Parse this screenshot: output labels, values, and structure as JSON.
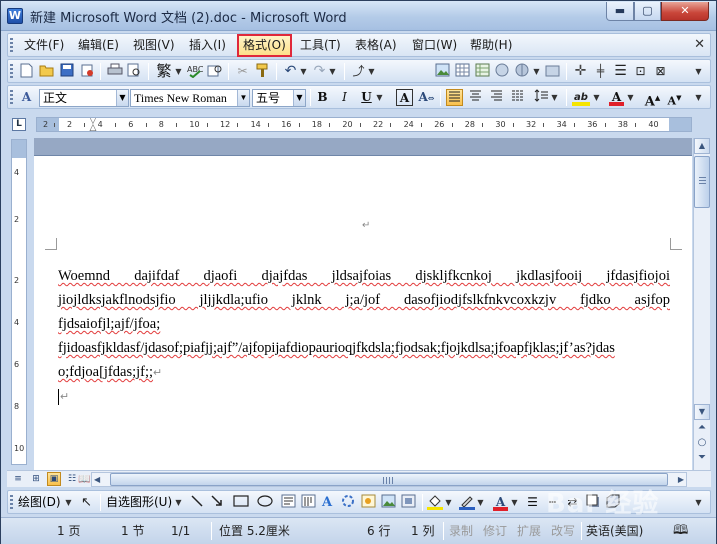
{
  "window": {
    "title": "新建 Microsoft Word 文档 (2).doc - Microsoft Word",
    "app_icon_letter": "W",
    "minimize_glyph": "▬",
    "maximize_glyph": "▢",
    "close_glyph": "✕"
  },
  "menubar": {
    "items": [
      {
        "label": "文件(F)"
      },
      {
        "label": "编辑(E)"
      },
      {
        "label": "视图(V)"
      },
      {
        "label": "插入(I)"
      },
      {
        "label": "格式(O)"
      },
      {
        "label": "工具(T)"
      },
      {
        "label": "表格(A)"
      },
      {
        "label": "窗口(W)"
      },
      {
        "label": "帮助(H)"
      }
    ],
    "active_item": "格式(O)",
    "doc_close_glyph": "✕"
  },
  "toolbar_standard": {
    "icons": [
      "new-icon",
      "open-icon",
      "save-icon",
      "permission-icon",
      "print-icon",
      "print-preview-icon",
      "traditional-chinese-icon",
      "spelling-icon",
      "research-icon",
      "cut-icon",
      "format-painter-icon",
      "undo-icon",
      "redo-icon",
      "hyperlink-icon",
      "insert-picture-icon",
      "tables-icon",
      "chart-icon",
      "columns-icon",
      "drawing-icon",
      "document-map-icon",
      "show-hide-icon"
    ],
    "traditional_chinese_glyph": "繁"
  },
  "toolbar_format": {
    "style_value": "正文",
    "font_value": "Times New Roman",
    "size_value": "五号",
    "bold_glyph": "B",
    "italic_glyph": "I",
    "underline_glyph": "U",
    "char_border_glyph": "A",
    "char_scale_glyph": "A",
    "highlight_glyph": "ab",
    "font_color_glyph": "A",
    "grow_font_glyph": "A",
    "shrink_font_glyph": "A",
    "highlight_color": "#f5e400",
    "font_color": "#e0202a",
    "style_icon_glyph": "A"
  },
  "ruler": {
    "corner_glyph": "L",
    "numbers": [
      "2",
      "2",
      "4",
      "6",
      "8",
      "10",
      "12",
      "14",
      "16",
      "18",
      "20",
      "22",
      "24",
      "26",
      "28",
      "30",
      "32",
      "34",
      "36",
      "38",
      "40"
    ],
    "vertical_numbers": [
      "4",
      "2",
      "2",
      "4",
      "6",
      "8",
      "10"
    ]
  },
  "document": {
    "header_mark": "↵",
    "lines": [
      "Woemnd dajifdaf djaofi djajfdas jldsajfoias djskljfkcnkoj jkdlasjfooij jfdasjfiojoi",
      "jiojldksjakflnodsjfio jljjkdla;ufio jklnk j;a/jof dasofjiodjfslkfnkvcoxkzjv fjdko asjfop",
      "fjdsaiofjl;ajf/jfoa;",
      "fjidoasfjkldasf/jdasof;piafjj;ajf”/ajfopijafdiopaurioqjfkdsla;fjodsak;fjojkdlsa;jfoapfjklas;jf’as?jdas",
      "o;fdjoa[jfdas;jf;;"
    ],
    "para_mark": "↵"
  },
  "drawing_toolbar": {
    "draw_label": "绘图(D)",
    "autoshapes_label": "自选图形(U)"
  },
  "statusbar": {
    "page": "1 页",
    "section": "1 节",
    "page_of": "1/1",
    "position": "位置 5.2厘米",
    "line": "6 行",
    "column": "1 列",
    "rec": "录制",
    "trk": "修订",
    "ext": "扩展",
    "ovr": "改写",
    "language": "英语(美国)"
  }
}
